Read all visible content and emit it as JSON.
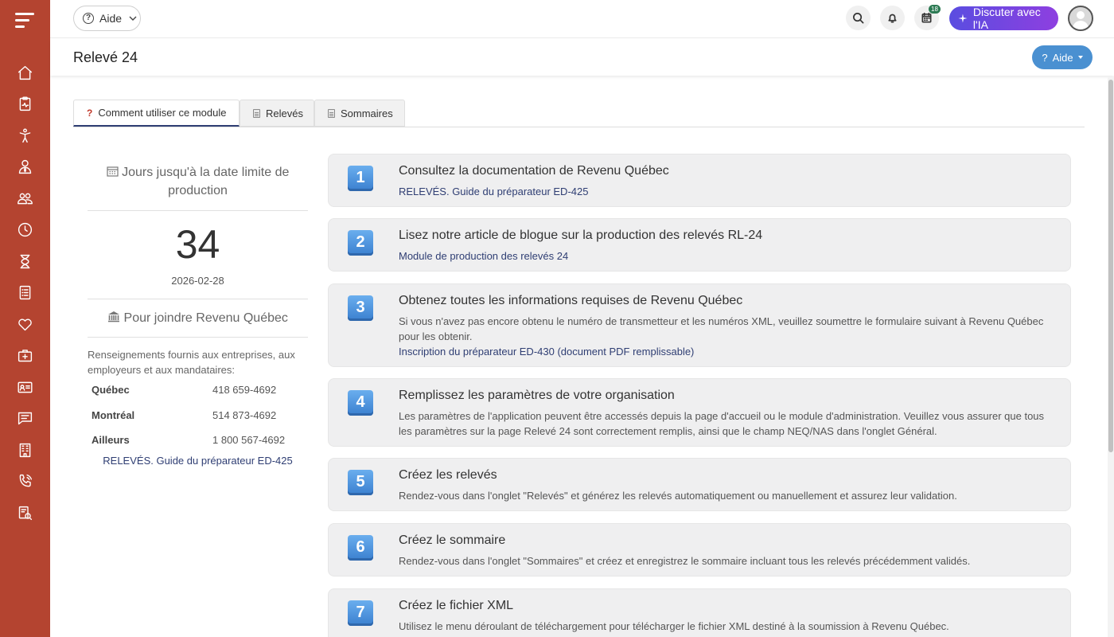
{
  "topbar": {
    "help_label": "Aide",
    "calendar_badge": "18",
    "ai_label": "Discuter avec l'IA"
  },
  "header": {
    "title": "Relevé 24",
    "aide_label": "Aide"
  },
  "tabs": [
    {
      "label": "Comment utiliser ce module",
      "icon": "question-icon",
      "active": true
    },
    {
      "label": "Relevés",
      "icon": "document-icon",
      "active": false
    },
    {
      "label": "Sommaires",
      "icon": "document-icon",
      "active": false
    }
  ],
  "deadline": {
    "title": "Jours jusqu'à la date limite de production",
    "days": "34",
    "date": "2026-02-28"
  },
  "contact": {
    "title": "Pour joindre Revenu Québec",
    "intro": "Renseignements fournis aux entreprises, aux employeurs et aux mandataires:",
    "rows": [
      {
        "city": "Québec",
        "phone": "418 659-4692"
      },
      {
        "city": "Montréal",
        "phone": "514 873-4692"
      },
      {
        "city": "Ailleurs",
        "phone": "1 800 567-4692"
      }
    ],
    "link": "RELEVÉS. Guide du préparateur ED-425"
  },
  "steps": [
    {
      "num": "1",
      "title": "Consultez la documentation de Revenu Québec",
      "desc": "",
      "link": "RELEVÉS. Guide du préparateur ED-425"
    },
    {
      "num": "2",
      "title": "Lisez notre article de blogue sur la production des relevés RL-24",
      "desc": "",
      "link": "Module de production des relevés 24"
    },
    {
      "num": "3",
      "title": "Obtenez toutes les informations requises de Revenu Québec",
      "desc": "Si vous n'avez pas encore obtenu le numéro de transmetteur et les numéros XML, veuillez soumettre le formulaire suivant à Revenu Québec pour les obtenir.",
      "link": "Inscription du préparateur ED-430 (document PDF remplissable)"
    },
    {
      "num": "4",
      "title": "Remplissez les paramètres de votre organisation",
      "desc": "Les paramètres de l'application peuvent être accessés depuis la page d'accueil ou le module d'administration. Veuillez vous assurer que tous les paramètres sur la page Relevé 24 sont correctement remplis, ainsi que le champ NEQ/NAS dans l'onglet Général.",
      "link": ""
    },
    {
      "num": "5",
      "title": "Créez les relevés",
      "desc": "Rendez-vous dans l'onglet \"Relevés\" et générez les relevés automatiquement ou manuellement et assurez leur validation.",
      "link": ""
    },
    {
      "num": "6",
      "title": "Créez le sommaire",
      "desc": "Rendez-vous dans l'onglet \"Sommaires\" et créez et enregistrez le sommaire incluant tous les relevés précédemment validés.",
      "link": ""
    },
    {
      "num": "7",
      "title": "Créez le fichier XML",
      "desc": "Utilisez le menu déroulant de téléchargement pour télécharger le fichier XML destiné à la soumission à Revenu Québec.",
      "link": ""
    }
  ],
  "sidebar_icons": [
    "home-icon",
    "clipboard-pulse-icon",
    "accessibility-icon",
    "user-tie-icon",
    "users-icon",
    "clock-icon",
    "hourglass-icon",
    "checklist-icon",
    "heart-icon",
    "medical-kit-icon",
    "id-card-icon",
    "chat-icon",
    "building-icon",
    "phone-ring-icon",
    "report-search-icon"
  ],
  "colors": {
    "sidebar": "#b44430",
    "accent": "#2f3e73",
    "ai_button": "#6c45e0",
    "aide_button": "#4a90d1"
  }
}
